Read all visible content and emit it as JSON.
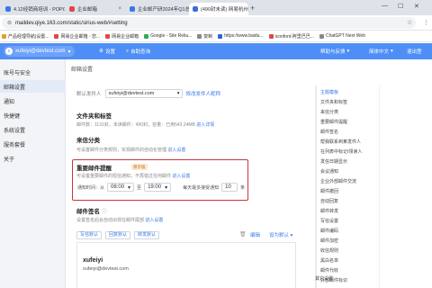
{
  "browser": {
    "tabs": [
      {
        "label": "4.12经销商培训 - POPO文档",
        "color": "#3a78e8"
      },
      {
        "label": "企业邮箱",
        "color": "#e04848"
      },
      {
        "label": "企业邮产研2024年Q1总结复",
        "color": "#3a78e8"
      },
      {
        "label": "(490封未读) 网易杭州网络",
        "color": "#3a6fd8"
      }
    ],
    "new_tab_glyph": "+",
    "url": "maildev.qiye.163.com/static/sirius-web/#setting",
    "bookmarks": [
      {
        "label": "产品经理导航|设置...",
        "color": "#e0a030"
      },
      {
        "label": "网易企业邮箱 - 您...",
        "color": "#e04848"
      },
      {
        "label": "网易企业邮箱",
        "color": "#e04848"
      },
      {
        "label": "Google - Site Relia...",
        "color": "#34a853"
      },
      {
        "label": "复制",
        "color": "#888888"
      },
      {
        "label": "https://www.baidu...",
        "color": "#2f64d8"
      },
      {
        "label": "iconfont-阿里巴巴...",
        "color": "#e04848"
      },
      {
        "label": "ChatGPT Next Web",
        "color": "#888888"
      }
    ]
  },
  "header": {
    "account": "xufeiyi@devtest.com",
    "avatar_letter": "x",
    "settings_label": "设置",
    "selfcheck_label": "自助查询",
    "help_label": "帮助与反馈",
    "lang_label": "简体中文",
    "logout_label": "退出登"
  },
  "sidebar": {
    "items": [
      {
        "label": "账号与安全",
        "active": false
      },
      {
        "label": "邮箱设置",
        "active": true
      },
      {
        "label": "通知",
        "active": false
      },
      {
        "label": "快捷键",
        "active": false
      },
      {
        "label": "系统设置",
        "active": false
      },
      {
        "label": "服务套餐",
        "active": false
      },
      {
        "label": "关于",
        "active": false
      }
    ]
  },
  "main": {
    "title": "邮箱设置",
    "sender": {
      "label": "默认发件人",
      "value": "xufeiyi@devtest.com",
      "link": "修改发件人昵称"
    },
    "folder": {
      "title": "文件夹和标签",
      "desc": "邮件数：1131封，未读邮件：490封，容量：已用543.24MB",
      "link": "进入详情"
    },
    "categories": {
      "title": "来信分类",
      "desc": "可设置邮件分类规则，实现邮件的自动化管理",
      "link": "进入设置"
    },
    "important": {
      "title": "重要邮件提醒",
      "badge": "尊享版",
      "desc": "可设置重要邮件的短信通知，不再错过任何邮件",
      "link": "进入设置",
      "notify_label": "通知时间：从",
      "start_time": "08:00",
      "to_label": "至",
      "end_time": "19:00",
      "max_label": "每天最多接受通知",
      "max_value": "10",
      "unit": "条"
    },
    "signature": {
      "title": "邮件签名",
      "desc": "设置签名后会自动出现在邮件尾部",
      "link": "进入设置",
      "tabs": [
        "写信默认",
        "回复默认",
        "转发默认"
      ],
      "edit_label": "编辑",
      "default_label": "设为默认",
      "name": "xufeiyi",
      "email": "xufeiyi@devtest.com"
    }
  },
  "right_panel": {
    "items": [
      {
        "label": "主题模板",
        "active": true
      },
      {
        "label": "文件夹和标签",
        "active": false
      },
      {
        "label": "来信分类",
        "active": false
      },
      {
        "label": "重要邮件提醒",
        "active": false
      },
      {
        "label": "邮件签名",
        "active": false
      },
      {
        "label": "帮我联系到某发件人",
        "active": false
      },
      {
        "label": "在列表中标记/领读人",
        "active": false
      },
      {
        "label": "发信日期显示",
        "active": false
      },
      {
        "label": "会议通知",
        "active": false
      },
      {
        "label": "企业外部邮件交流",
        "active": false
      },
      {
        "label": "邮件撤回",
        "active": false
      },
      {
        "label": "自动回复",
        "active": false
      },
      {
        "label": "邮件转发",
        "active": false
      },
      {
        "label": "写信设置",
        "active": false
      },
      {
        "label": "邮件编码",
        "active": false
      },
      {
        "label": "邮件加密",
        "active": false
      },
      {
        "label": "收信规则",
        "active": false
      },
      {
        "label": "黑白名单",
        "active": false
      },
      {
        "label": "邮件代收",
        "active": false
      },
      {
        "label": "外部邮件标识",
        "active": false
      },
      {
        "label": "其它设置",
        "active": false
      }
    ]
  },
  "colors": {
    "brand": "#4f8ef7",
    "link": "#3a78e8",
    "highlight_border": "#c7363a"
  }
}
